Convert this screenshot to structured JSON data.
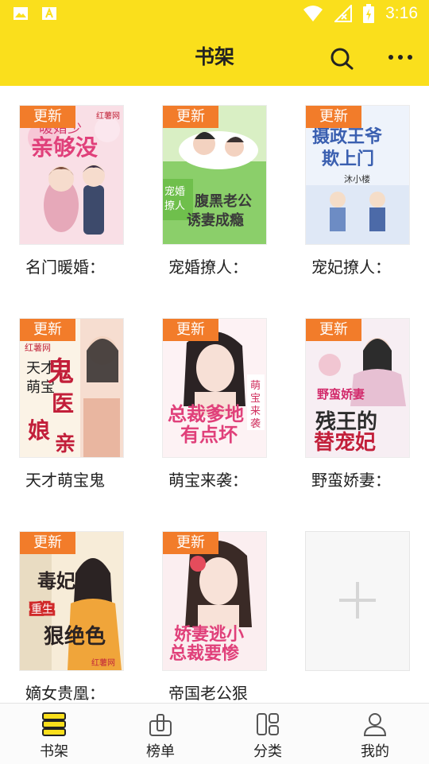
{
  "status_bar": {
    "time": "3:16"
  },
  "app_bar": {
    "title": "书架"
  },
  "badge_label": "更新",
  "books": [
    {
      "title": "名门暖婚：",
      "cover_text": "红薯网"
    },
    {
      "title": "宠婚撩人：",
      "cover_text": "腹黑老公诱妻成瘾"
    },
    {
      "title": "宠妃撩人：",
      "cover_text": "摄政王爷欺上门"
    },
    {
      "title": "天才萌宝鬼",
      "cover_text": "鬼医娘亲"
    },
    {
      "title": "萌宝来袭：",
      "cover_text": "总裁爹地有点坏"
    },
    {
      "title": "野蛮娇妻：",
      "cover_text": "残王的替宠妃"
    },
    {
      "title": "嫡女贵凰：",
      "cover_text": "毒妃狠绝色"
    },
    {
      "title": "帝国老公狠",
      "cover_text": "娇妻逃小总裁要惨"
    }
  ],
  "tabs": [
    {
      "label": "书架",
      "icon": "bookshelf-icon",
      "active": true
    },
    {
      "label": "榜单",
      "icon": "ranking-icon",
      "active": false
    },
    {
      "label": "分类",
      "icon": "category-icon",
      "active": false
    },
    {
      "label": "我的",
      "icon": "profile-icon",
      "active": false
    }
  ],
  "colors": {
    "brand": "#fadf1c",
    "badge": "#f27c2a",
    "active_tab": "#fadf1c"
  }
}
